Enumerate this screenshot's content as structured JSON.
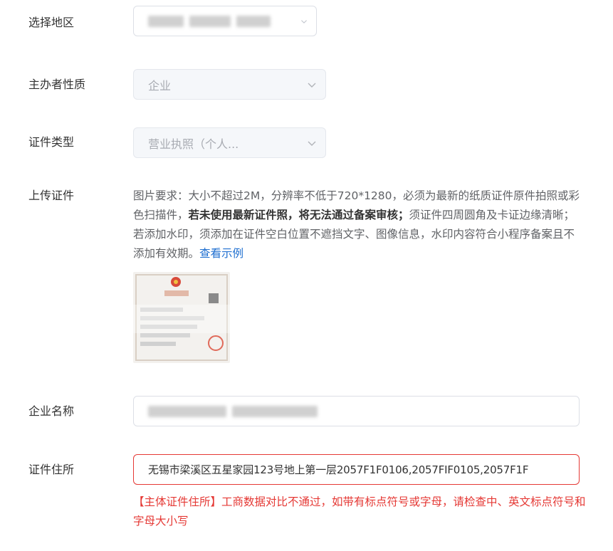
{
  "form": {
    "region": {
      "label": "选择地区",
      "value_redacted": true
    },
    "organizer_type": {
      "label": "主办者性质",
      "value": "企业"
    },
    "cert_type": {
      "label": "证件类型",
      "value": "营业执照（个人..."
    },
    "upload": {
      "label": "上传证件",
      "desc_1": "图片要求：大小不超过2M，分辨率不低于720*1280，必须为最新的纸质证件原件拍照或彩色扫描件，",
      "desc_bold": "若未使用最新证件照，将无法通过备案审核；",
      "desc_2": "须证件四周圆角及卡证边缘清晰；若添加水印，须添加在证件空白位置不遮挡文字、图像信息，水印内容符合小程序备案且不添加有效期。",
      "example_link": "查看示例"
    },
    "company_name": {
      "label": "企业名称",
      "value_redacted": true
    },
    "cert_address": {
      "label": "证件住所",
      "value": "无锡市梁溪区五星家园123号地上第一层2057F1F0106,2057FIF0105,2057F1F",
      "error": "【主体证件住所】工商数据对比不通过，如带有标点符号或字母，请检查中、英文标点符号和字母大小写"
    }
  },
  "colors": {
    "error": "#e53935",
    "link": "#1f6fd0",
    "border": "#dcdfe6",
    "disabled_bg": "#f5f7fa"
  }
}
